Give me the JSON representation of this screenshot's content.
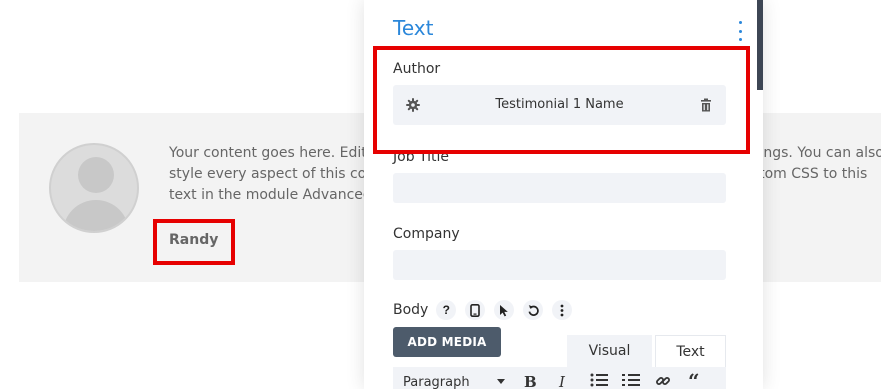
{
  "background": {
    "content_text": "Your content goes here. Edit or remove this text inline or in the module Content settings. You can also style every aspect of this content in the module Design settings and even apply custom CSS to this text in the module Advanced settings.",
    "author_name": "Randy"
  },
  "panel": {
    "section_title": "Text",
    "fields": {
      "author_label": "Author",
      "author_value": "Testimonial 1 Name",
      "job_title_label": "Job Title",
      "job_title_value": "",
      "company_label": "Company",
      "company_value": "",
      "body_label": "Body"
    },
    "body_icons": [
      "help-icon",
      "mobile-icon",
      "cursor-icon",
      "undo-icon",
      "more-icon"
    ],
    "add_media_label": "ADD MEDIA",
    "tabs": {
      "visual": "Visual",
      "text": "Text"
    },
    "toolbar": {
      "format_label": "Paragraph",
      "buttons": [
        "bold",
        "italic",
        "bullet-list",
        "numbered-list",
        "link",
        "blockquote"
      ]
    }
  },
  "colors": {
    "accent": "#2b87da",
    "highlight": "#e60000",
    "button": "#4d5b6b"
  }
}
